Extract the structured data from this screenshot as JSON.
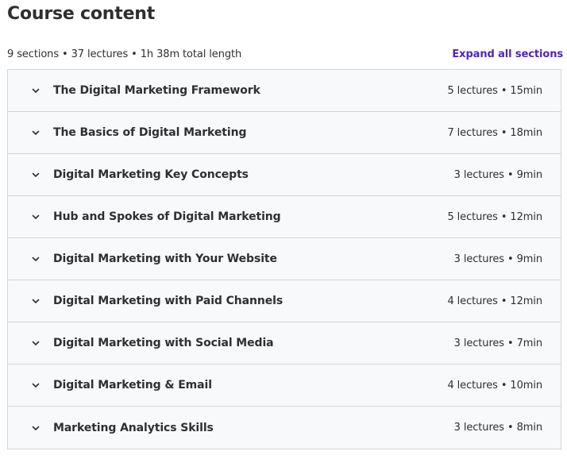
{
  "header": {
    "title": "Course content",
    "summary": "9 sections • 37 lectures • 1h 38m total length",
    "expand_all_label": "Expand all sections"
  },
  "sections": [
    {
      "title": "The Digital Marketing Framework",
      "meta": "5 lectures • 15min"
    },
    {
      "title": "The Basics of Digital Marketing",
      "meta": "7 lectures • 18min"
    },
    {
      "title": "Digital Marketing Key Concepts",
      "meta": "3 lectures • 9min"
    },
    {
      "title": "Hub and Spokes of Digital Marketing",
      "meta": "5 lectures • 12min"
    },
    {
      "title": "Digital Marketing with Your Website",
      "meta": "3 lectures • 9min"
    },
    {
      "title": "Digital Marketing with Paid Channels",
      "meta": "4 lectures • 12min"
    },
    {
      "title": "Digital Marketing with Social Media",
      "meta": "3 lectures • 7min"
    },
    {
      "title": "Digital Marketing & Email",
      "meta": "4 lectures • 10min"
    },
    {
      "title": "Marketing Analytics Skills",
      "meta": "3 lectures • 8min"
    }
  ],
  "icons": {
    "section_toggle": "chevron-down-icon"
  },
  "colors": {
    "text": "#2d2f31",
    "link": "#5022c3",
    "row_background": "#f7f9fa",
    "border": "#d1d7dc"
  }
}
